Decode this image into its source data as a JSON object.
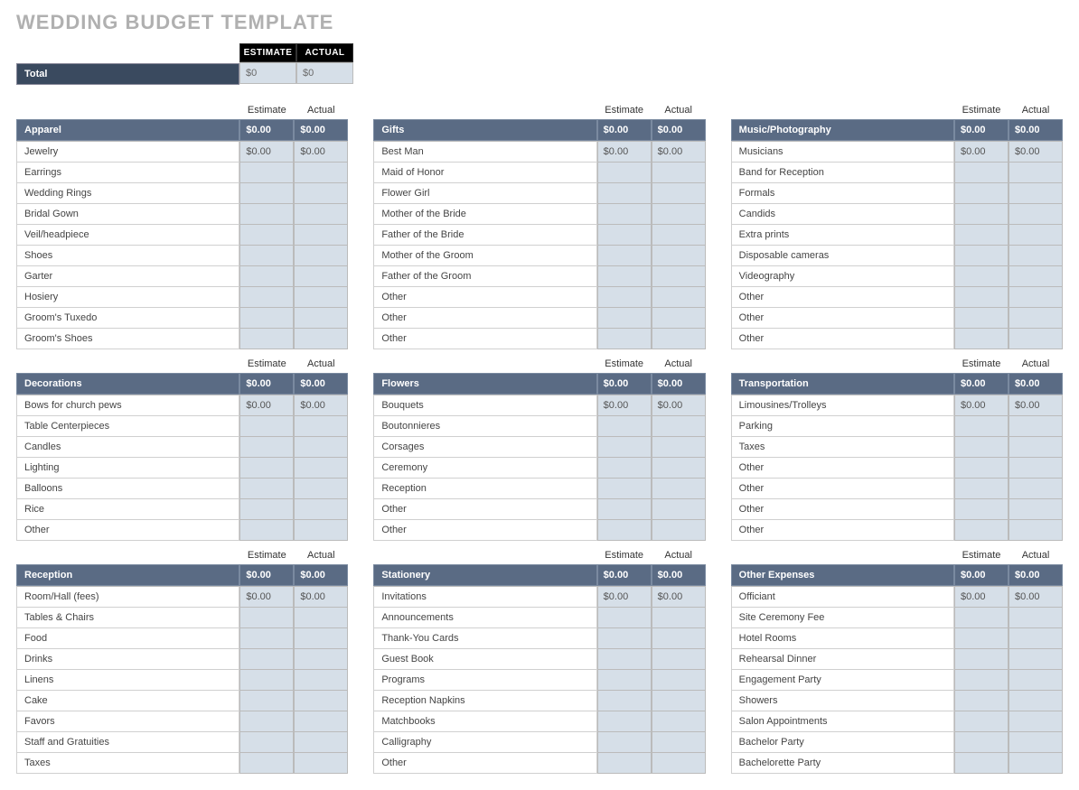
{
  "title": "WEDDING BUDGET TEMPLATE",
  "headers": {
    "estimate": "ESTIMATE",
    "actual": "ACTUAL",
    "estimate_lc": "Estimate",
    "actual_lc": "Actual"
  },
  "total": {
    "label": "Total",
    "estimate": "$0",
    "actual": "$0"
  },
  "columns": [
    [
      {
        "name": "Apparel",
        "est": "$0.00",
        "act": "$0.00",
        "items": [
          {
            "n": "Jewelry",
            "e": "$0.00",
            "a": "$0.00"
          },
          {
            "n": "Earrings",
            "e": "",
            "a": ""
          },
          {
            "n": "Wedding Rings",
            "e": "",
            "a": ""
          },
          {
            "n": "Bridal Gown",
            "e": "",
            "a": ""
          },
          {
            "n": "Veil/headpiece",
            "e": "",
            "a": ""
          },
          {
            "n": "Shoes",
            "e": "",
            "a": ""
          },
          {
            "n": "Garter",
            "e": "",
            "a": ""
          },
          {
            "n": "Hosiery",
            "e": "",
            "a": ""
          },
          {
            "n": "Groom's Tuxedo",
            "e": "",
            "a": ""
          },
          {
            "n": "Groom's Shoes",
            "e": "",
            "a": ""
          }
        ]
      },
      {
        "name": "Decorations",
        "est": "$0.00",
        "act": "$0.00",
        "items": [
          {
            "n": "Bows for church pews",
            "e": "$0.00",
            "a": "$0.00"
          },
          {
            "n": "Table Centerpieces",
            "e": "",
            "a": ""
          },
          {
            "n": "Candles",
            "e": "",
            "a": ""
          },
          {
            "n": "Lighting",
            "e": "",
            "a": ""
          },
          {
            "n": "Balloons",
            "e": "",
            "a": ""
          },
          {
            "n": "Rice",
            "e": "",
            "a": ""
          },
          {
            "n": "Other",
            "e": "",
            "a": ""
          }
        ]
      },
      {
        "name": "Reception",
        "est": "$0.00",
        "act": "$0.00",
        "items": [
          {
            "n": "Room/Hall (fees)",
            "e": "$0.00",
            "a": "$0.00"
          },
          {
            "n": "Tables & Chairs",
            "e": "",
            "a": ""
          },
          {
            "n": "Food",
            "e": "",
            "a": ""
          },
          {
            "n": "Drinks",
            "e": "",
            "a": ""
          },
          {
            "n": "Linens",
            "e": "",
            "a": ""
          },
          {
            "n": "Cake",
            "e": "",
            "a": ""
          },
          {
            "n": "Favors",
            "e": "",
            "a": ""
          },
          {
            "n": "Staff and Gratuities",
            "e": "",
            "a": ""
          },
          {
            "n": "Taxes",
            "e": "",
            "a": ""
          }
        ]
      }
    ],
    [
      {
        "name": "Gifts",
        "est": "$0.00",
        "act": "$0.00",
        "items": [
          {
            "n": "Best Man",
            "e": "$0.00",
            "a": "$0.00"
          },
          {
            "n": "Maid of Honor",
            "e": "",
            "a": ""
          },
          {
            "n": "Flower Girl",
            "e": "",
            "a": ""
          },
          {
            "n": "Mother of the Bride",
            "e": "",
            "a": ""
          },
          {
            "n": "Father of the Bride",
            "e": "",
            "a": ""
          },
          {
            "n": "Mother of the Groom",
            "e": "",
            "a": ""
          },
          {
            "n": "Father of the Groom",
            "e": "",
            "a": ""
          },
          {
            "n": "Other",
            "e": "",
            "a": ""
          },
          {
            "n": "Other",
            "e": "",
            "a": ""
          },
          {
            "n": "Other",
            "e": "",
            "a": ""
          }
        ]
      },
      {
        "name": "Flowers",
        "est": "$0.00",
        "act": "$0.00",
        "items": [
          {
            "n": "Bouquets",
            "e": "$0.00",
            "a": "$0.00"
          },
          {
            "n": "Boutonnieres",
            "e": "",
            "a": ""
          },
          {
            "n": "Corsages",
            "e": "",
            "a": ""
          },
          {
            "n": "Ceremony",
            "e": "",
            "a": ""
          },
          {
            "n": "Reception",
            "e": "",
            "a": ""
          },
          {
            "n": "Other",
            "e": "",
            "a": ""
          },
          {
            "n": "Other",
            "e": "",
            "a": ""
          }
        ]
      },
      {
        "name": "Stationery",
        "est": "$0.00",
        "act": "$0.00",
        "items": [
          {
            "n": "Invitations",
            "e": "$0.00",
            "a": "$0.00"
          },
          {
            "n": "Announcements",
            "e": "",
            "a": ""
          },
          {
            "n": "Thank-You Cards",
            "e": "",
            "a": ""
          },
          {
            "n": "Guest Book",
            "e": "",
            "a": ""
          },
          {
            "n": "Programs",
            "e": "",
            "a": ""
          },
          {
            "n": "Reception Napkins",
            "e": "",
            "a": ""
          },
          {
            "n": "Matchbooks",
            "e": "",
            "a": ""
          },
          {
            "n": "Calligraphy",
            "e": "",
            "a": ""
          },
          {
            "n": "Other",
            "e": "",
            "a": ""
          }
        ]
      }
    ],
    [
      {
        "name": "Music/Photography",
        "est": "$0.00",
        "act": "$0.00",
        "items": [
          {
            "n": "Musicians",
            "e": "$0.00",
            "a": "$0.00"
          },
          {
            "n": "Band for Reception",
            "e": "",
            "a": ""
          },
          {
            "n": "Formals",
            "e": "",
            "a": ""
          },
          {
            "n": "Candids",
            "e": "",
            "a": ""
          },
          {
            "n": "Extra prints",
            "e": "",
            "a": ""
          },
          {
            "n": "Disposable cameras",
            "e": "",
            "a": ""
          },
          {
            "n": "Videography",
            "e": "",
            "a": ""
          },
          {
            "n": "Other",
            "e": "",
            "a": ""
          },
          {
            "n": "Other",
            "e": "",
            "a": ""
          },
          {
            "n": "Other",
            "e": "",
            "a": ""
          }
        ]
      },
      {
        "name": "Transportation",
        "est": "$0.00",
        "act": "$0.00",
        "items": [
          {
            "n": "Limousines/Trolleys",
            "e": "$0.00",
            "a": "$0.00"
          },
          {
            "n": "Parking",
            "e": "",
            "a": ""
          },
          {
            "n": "Taxes",
            "e": "",
            "a": ""
          },
          {
            "n": "Other",
            "e": "",
            "a": ""
          },
          {
            "n": "Other",
            "e": "",
            "a": ""
          },
          {
            "n": "Other",
            "e": "",
            "a": ""
          },
          {
            "n": "Other",
            "e": "",
            "a": ""
          }
        ]
      },
      {
        "name": "Other Expenses",
        "est": "$0.00",
        "act": "$0.00",
        "items": [
          {
            "n": "Officiant",
            "e": "$0.00",
            "a": "$0.00"
          },
          {
            "n": "Site Ceremony Fee",
            "e": "",
            "a": ""
          },
          {
            "n": "Hotel Rooms",
            "e": "",
            "a": ""
          },
          {
            "n": "Rehearsal Dinner",
            "e": "",
            "a": ""
          },
          {
            "n": "Engagement Party",
            "e": "",
            "a": ""
          },
          {
            "n": "Showers",
            "e": "",
            "a": ""
          },
          {
            "n": "Salon Appointments",
            "e": "",
            "a": ""
          },
          {
            "n": "Bachelor Party",
            "e": "",
            "a": ""
          },
          {
            "n": "Bachelorette Party",
            "e": "",
            "a": ""
          }
        ]
      }
    ]
  ]
}
